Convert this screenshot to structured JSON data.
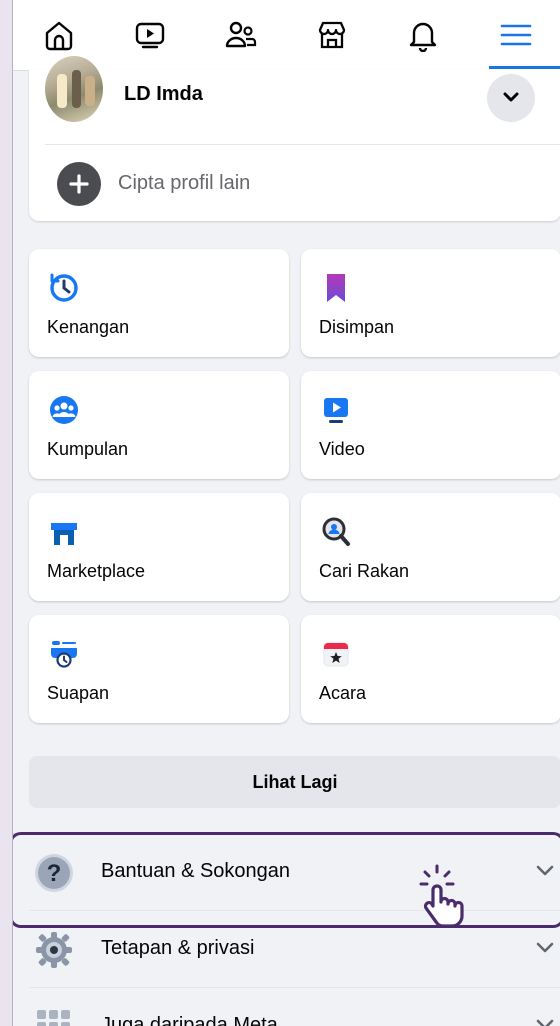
{
  "nav": {
    "tabs": [
      {
        "name": "home",
        "icon": "home-icon"
      },
      {
        "name": "watch",
        "icon": "video-icon"
      },
      {
        "name": "friends",
        "icon": "friends-icon"
      },
      {
        "name": "marketplace",
        "icon": "marketplace-icon"
      },
      {
        "name": "notifications",
        "icon": "bell-icon"
      },
      {
        "name": "menu",
        "icon": "hamburger-menu-icon",
        "active": true
      }
    ],
    "active_color": "#1b74e4"
  },
  "account": {
    "name": "LD Imda",
    "create_profile_label": "Cipta profil lain"
  },
  "shortcuts": [
    {
      "label": "Kenangan",
      "icon": "memories-clock-icon"
    },
    {
      "label": "Disimpan",
      "icon": "saved-bookmark-icon"
    },
    {
      "label": "Kumpulan",
      "icon": "groups-icon"
    },
    {
      "label": "Video",
      "icon": "video-play-icon"
    },
    {
      "label": "Marketplace",
      "icon": "marketplace-store-icon"
    },
    {
      "label": "Cari Rakan",
      "icon": "find-friends-search-icon"
    },
    {
      "label": "Suapan",
      "icon": "feeds-icon"
    },
    {
      "label": "Acara",
      "icon": "events-calendar-icon"
    }
  ],
  "see_more_label": "Lihat Lagi",
  "menu_sections": [
    {
      "label": "Bantuan & Sokongan",
      "icon": "help-question-icon"
    },
    {
      "label": "Tetapan & privasi",
      "icon": "settings-gear-icon",
      "highlighted": true
    },
    {
      "label": "Juga daripada Meta",
      "icon": "meta-apps-grid-icon"
    }
  ],
  "colors": {
    "highlight": "#4a2c6d",
    "background": "#f0f2f5"
  }
}
